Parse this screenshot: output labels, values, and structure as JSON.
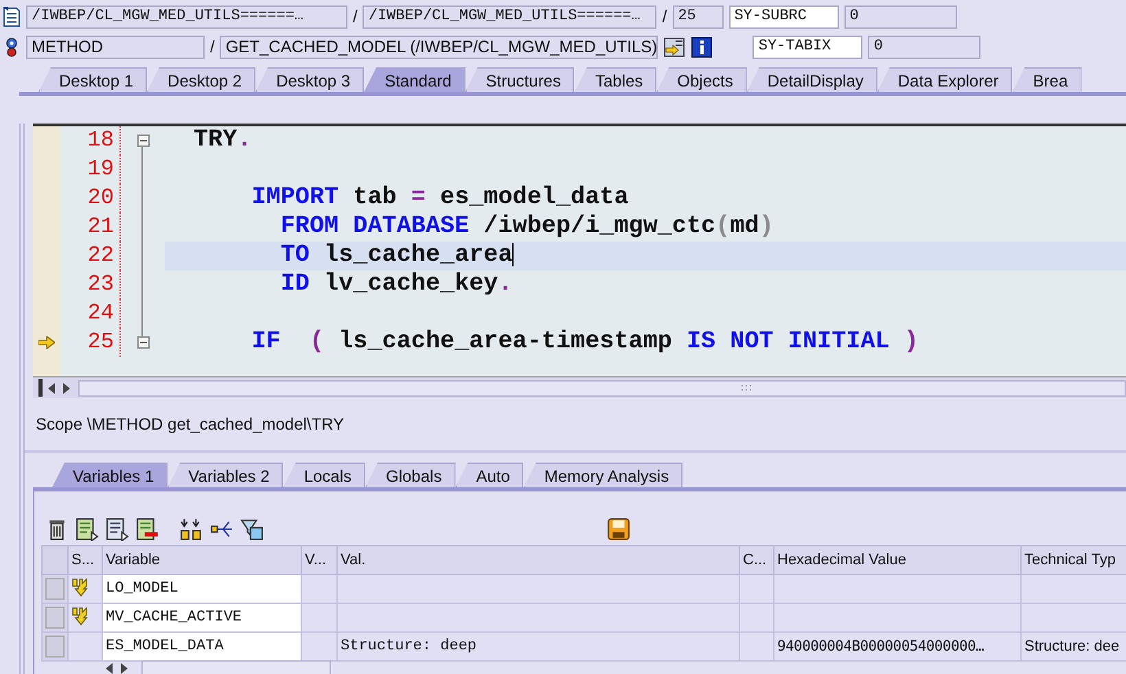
{
  "header": {
    "row1": {
      "program": "/IWBEP/CL_MGW_MED_UTILS======…",
      "separator_1": "/",
      "include": "/IWBEP/CL_MGW_MED_UTILS======…",
      "separator_2": "/",
      "line": "25",
      "sysvar_name": "SY-SUBRC",
      "sysvar_value": "0"
    },
    "row2": {
      "event_type": "METHOD",
      "separator": "/",
      "event_name": "GET_CACHED_MODEL (/IWBEP/CL_MGW_MED_UTILS)",
      "sysvar_name": "SY-TABIX",
      "sysvar_value": "0"
    }
  },
  "desktop_tabs": [
    {
      "label": "Desktop 1",
      "selected": false
    },
    {
      "label": "Desktop 2",
      "selected": false
    },
    {
      "label": "Desktop 3",
      "selected": false
    },
    {
      "label": "Standard",
      "selected": true
    },
    {
      "label": "Structures",
      "selected": false
    },
    {
      "label": "Tables",
      "selected": false
    },
    {
      "label": "Objects",
      "selected": false
    },
    {
      "label": "DetailDisplay",
      "selected": false
    },
    {
      "label": "Data Explorer",
      "selected": false
    },
    {
      "label": "Brea",
      "selected": false
    }
  ],
  "editor": {
    "lines": [
      {
        "number": "18",
        "fold": true,
        "execution_point": false,
        "highlighted": false,
        "tokens": [
          {
            "kind": "plain",
            "text": "TRY"
          },
          {
            "kind": "punct",
            "text": "."
          }
        ],
        "children": [
          {
            "number": "19",
            "fold": false,
            "execution_point": false,
            "highlighted": false
          },
          {
            "number": "20",
            "fold": false,
            "execution_point": false,
            "highlighted": false,
            "tokens": [
              {
                "kind": "keyword",
                "text": "IMPORT"
              },
              {
                "kind": "plain",
                "text": " tab "
              },
              {
                "kind": "punct",
                "text": "="
              },
              {
                "kind": "plain",
                "text": " es_model_data"
              }
            ],
            "children": [
              {
                "number": "21",
                "fold": false,
                "execution_point": false,
                "highlighted": false,
                "tokens": [
                  {
                    "kind": "keyword",
                    "text": "FROM DATABASE"
                  },
                  {
                    "kind": "plain",
                    "text": " /iwbep/i_mgw_ctc"
                  },
                  {
                    "kind": "paren",
                    "text": "("
                  },
                  {
                    "kind": "plain",
                    "text": "md"
                  },
                  {
                    "kind": "paren",
                    "text": ")"
                  }
                ]
              },
              {
                "number": "22",
                "fold": false,
                "execution_point": false,
                "highlighted": true,
                "tokens": [
                  {
                    "kind": "keyword",
                    "text": "TO"
                  },
                  {
                    "kind": "plain",
                    "text": " ls_cache_area"
                  }
                ]
              },
              {
                "number": "23",
                "fold": false,
                "execution_point": false,
                "highlighted": false,
                "tokens": [
                  {
                    "kind": "keyword",
                    "text": "ID"
                  },
                  {
                    "kind": "plain",
                    "text": " lv_cache_key"
                  },
                  {
                    "kind": "punct",
                    "text": "."
                  }
                ]
              }
            ]
          },
          {
            "number": "24",
            "fold": false,
            "execution_point": false,
            "highlighted": false
          },
          {
            "number": "25",
            "fold": true,
            "execution_point": true,
            "highlighted": false,
            "tokens": [
              {
                "kind": "keyword",
                "text": "IF"
              },
              {
                "kind": "punct",
                "text": "  ("
              },
              {
                "kind": "plain",
                "text": " ls_cache_area-timestamp "
              },
              {
                "kind": "keyword",
                "text": "IS NOT INITIAL"
              },
              {
                "kind": "punct",
                "text": " )"
              }
            ]
          }
        ]
      }
    ]
  },
  "scope": "Scope \\METHOD get_cached_model\\TRY",
  "variable_tabs": [
    {
      "label": "Variables 1",
      "selected": true
    },
    {
      "label": "Variables 2",
      "selected": false
    },
    {
      "label": "Locals",
      "selected": false
    },
    {
      "label": "Globals",
      "selected": false
    },
    {
      "label": "Auto",
      "selected": false
    },
    {
      "label": "Memory Analysis",
      "selected": false
    }
  ],
  "table": {
    "columns": [
      "S...",
      "Variable",
      "V...",
      "Val.",
      "C...",
      "Hexadecimal Value",
      "Technical Typ"
    ],
    "rows": [
      {
        "changed": true,
        "variable": "LO_MODEL"
      },
      {
        "changed": true,
        "variable": "MV_CACHE_ACTIVE"
      },
      {
        "changed": false,
        "variable": "ES_MODEL_DATA",
        "value": "Structure: deep",
        "hex": "940000004B00000054000000…",
        "type": "Structure: dee"
      }
    ]
  }
}
